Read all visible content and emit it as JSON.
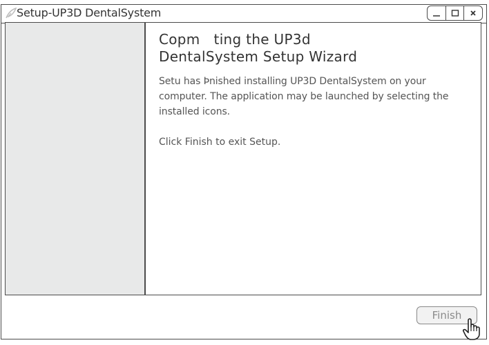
{
  "window": {
    "title": "Setup-UP3D DentalSystem",
    "controls": {
      "minimize": "—",
      "maximize": "☐",
      "close": "×"
    }
  },
  "main": {
    "heading_line1": "Copm   ting the UP3d",
    "heading_line2": "DentalSystem Setup Wizard",
    "paragraph1": "Setu has Þnished installing UP3D DentalSystem on your computer. The application may be launched by selecting the installed icons.",
    "paragraph2": "Click Finish to exit Setup."
  },
  "footer": {
    "finish_label": "Finish"
  },
  "icons": {
    "app": "app-logo-icon",
    "cursor": "hand-pointer-icon"
  }
}
